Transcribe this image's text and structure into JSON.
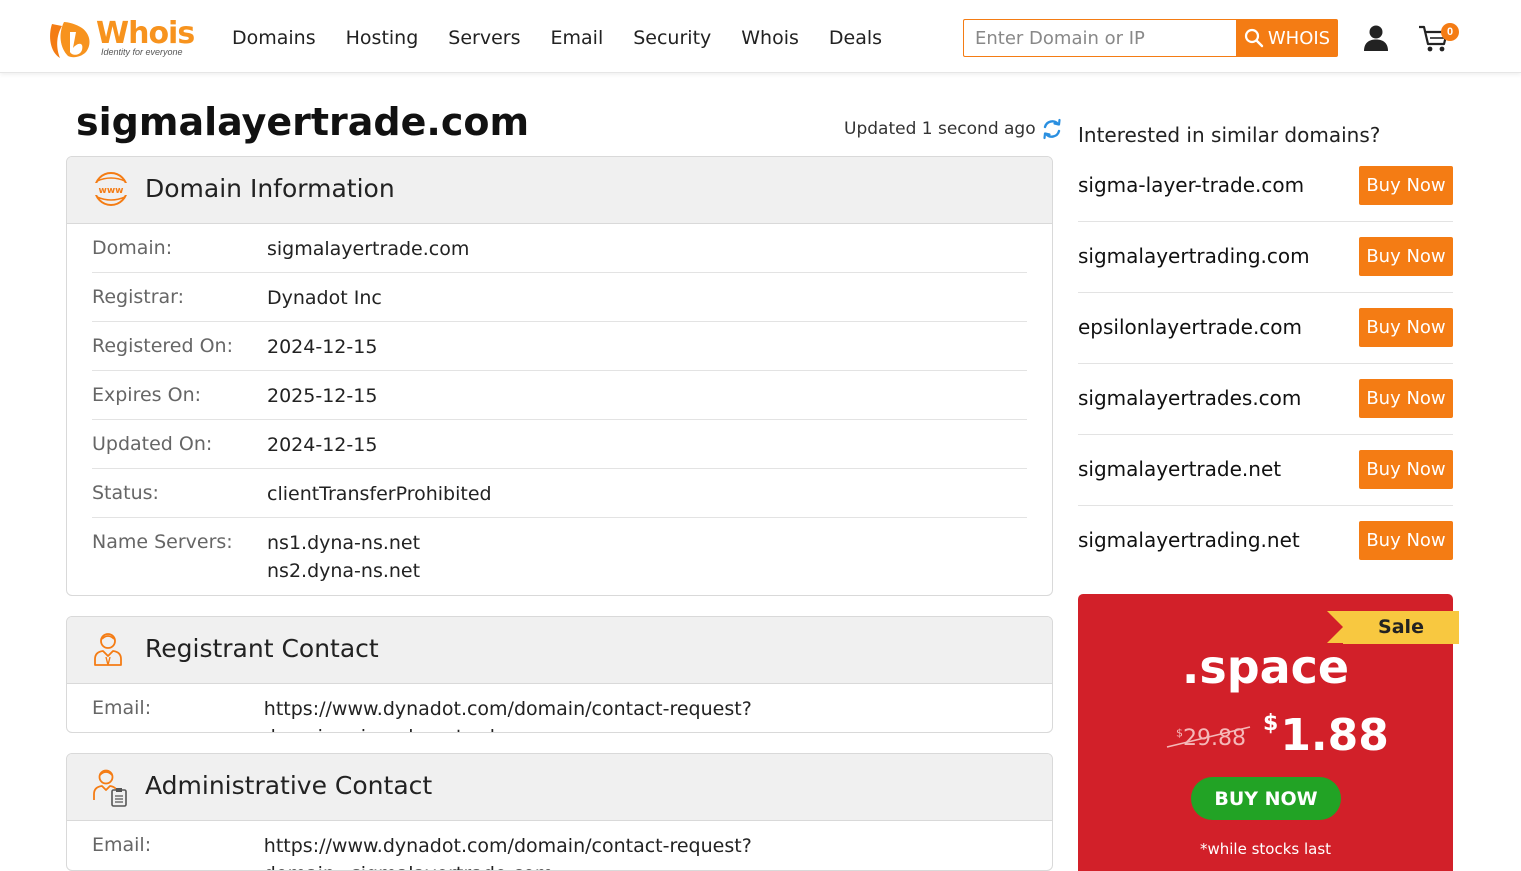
{
  "header": {
    "logo_text": "Whois",
    "logo_tagline": "Identity for everyone",
    "nav": [
      "Domains",
      "Hosting",
      "Servers",
      "Email",
      "Security",
      "Whois",
      "Deals"
    ],
    "search_placeholder": "Enter Domain or IP",
    "search_button": "WHOIS",
    "cart_count": "0",
    "accent_color": "#f47c14"
  },
  "main": {
    "title": "sigmalayertrade.com",
    "updated": "Updated 1 second ago",
    "domain_info": {
      "heading": "Domain Information",
      "rows": [
        {
          "label": "Domain:",
          "value": "sigmalayertrade.com"
        },
        {
          "label": "Registrar:",
          "value": "Dynadot Inc"
        },
        {
          "label": "Registered On:",
          "value": "2024-12-15"
        },
        {
          "label": "Expires On:",
          "value": "2025-12-15"
        },
        {
          "label": "Updated On:",
          "value": "2024-12-15"
        },
        {
          "label": "Status:",
          "value": "clientTransferProhibited"
        },
        {
          "label": "Name Servers:",
          "value": [
            "ns1.dyna-ns.net",
            "ns2.dyna-ns.net"
          ]
        }
      ]
    },
    "registrant": {
      "heading": "Registrant Contact",
      "label": "Email:",
      "value": "https://www.dynadot.com/domain/contact-request?domain=sigmalayertrade.com"
    },
    "administrative": {
      "heading": "Administrative Contact",
      "label": "Email:",
      "value": "https://www.dynadot.com/domain/contact-request?domain=sigmalayertrade.com"
    }
  },
  "sidebar": {
    "title": "Interested in similar domains?",
    "buy_label": "Buy Now",
    "suggestions": [
      "sigma-layer-trade.com",
      "sigmalayertrading.com",
      "epsilonlayertrade.com",
      "sigmalayertrades.com",
      "sigmalayertrade.net",
      "sigmalayertrading.net"
    ],
    "promo": {
      "ribbon": "Sale",
      "tld": ".space",
      "currency": "$",
      "old_price": "29.88",
      "new_price": "1.88",
      "button": "BUY NOW",
      "note": "*while stocks last",
      "bg_color": "#d22029",
      "button_color": "#22a325"
    }
  }
}
